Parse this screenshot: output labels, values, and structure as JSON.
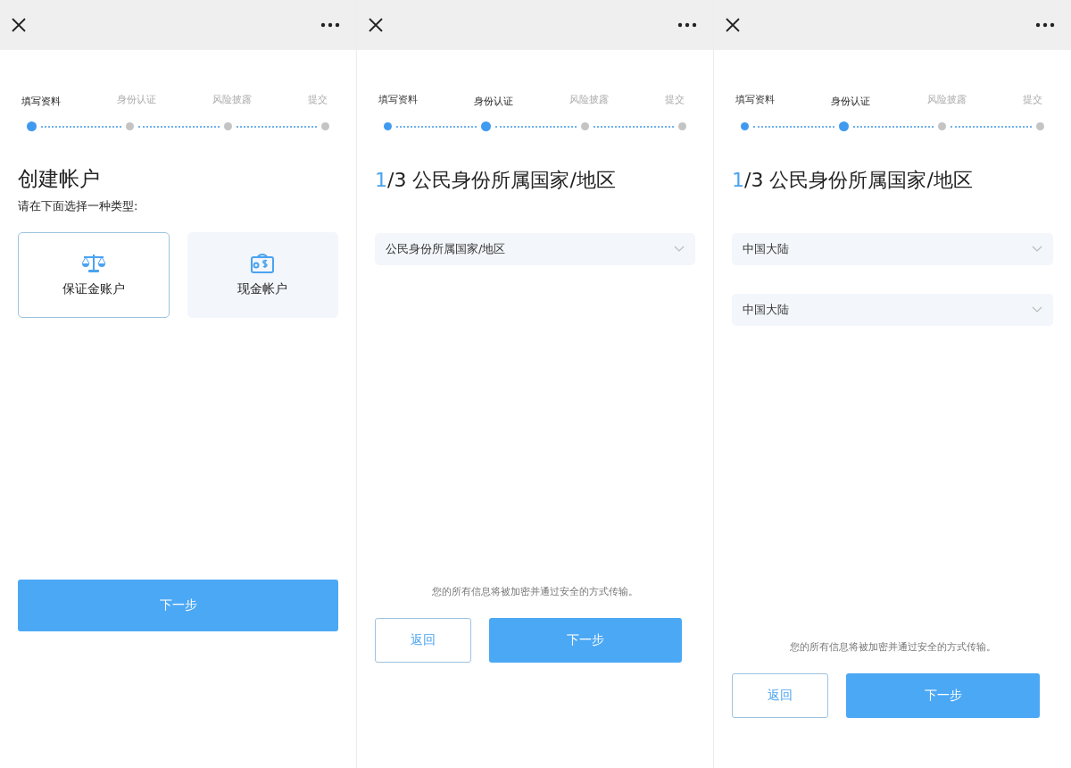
{
  "screens": [
    {
      "kind": "account-type",
      "steps": [
        {
          "label": "填写资料",
          "completed": false,
          "selected": true
        },
        {
          "label": "身份认证",
          "completed": false,
          "selected": false
        },
        {
          "label": "风险披露",
          "completed": false,
          "selected": false
        },
        {
          "label": "提交",
          "completed": false,
          "selected": false
        }
      ],
      "title": "创建帐户",
      "subtitle": "请在下面选择一种类型:",
      "options": [
        {
          "kind": "margin",
          "label": "保证金账户",
          "selected": true
        },
        {
          "kind": "cash",
          "label": "现金帐户",
          "selected": false
        }
      ],
      "buttons": [
        {
          "kind": "primary",
          "label": "下一步"
        }
      ]
    },
    {
      "kind": "form",
      "steps": [
        {
          "label": "填写资料",
          "completed": true,
          "selected": false
        },
        {
          "label": "身份认证",
          "completed": false,
          "selected": true
        },
        {
          "label": "风险披露",
          "completed": false,
          "selected": false
        },
        {
          "label": "提交",
          "completed": false,
          "selected": false
        }
      ],
      "heading": {
        "index": "1",
        "rest": "/3 公民身份所属国家/地区"
      },
      "selects": [
        {
          "placeholder": "公民身份所属国家/地区"
        }
      ],
      "note": "您的所有信息将被加密并通过安全的方式传输。",
      "buttons": [
        {
          "kind": "secondary",
          "label": "返回"
        },
        {
          "kind": "primary",
          "label": "下一步"
        }
      ]
    },
    {
      "kind": "form",
      "steps": [
        {
          "label": "填写资料",
          "completed": true,
          "selected": false
        },
        {
          "label": "身份认证",
          "completed": false,
          "selected": true
        },
        {
          "label": "风险披露",
          "completed": false,
          "selected": false
        },
        {
          "label": "提交",
          "completed": false,
          "selected": false
        }
      ],
      "heading": {
        "index": "1",
        "rest": "/3 公民身份所属国家/地区"
      },
      "selects": [
        {
          "value": "中国大陆"
        },
        {
          "value": "中国大陆"
        }
      ],
      "note": "您的所有信息将被加密并通过安全的方式传输。",
      "buttons": [
        {
          "kind": "secondary",
          "label": "返回"
        },
        {
          "kind": "primary",
          "label": "下一步"
        }
      ]
    }
  ]
}
